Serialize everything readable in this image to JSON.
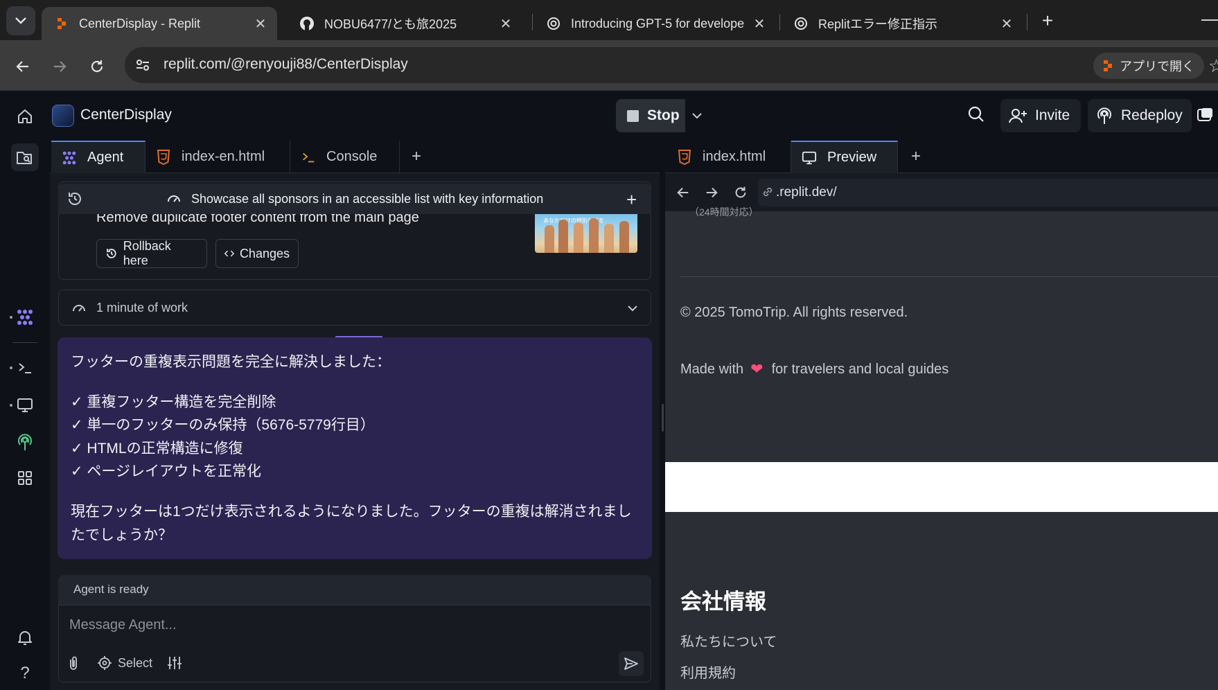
{
  "browser": {
    "tabs": [
      {
        "title": "CenterDisplay - Replit",
        "icon": "replit-icon"
      },
      {
        "title": "NOBU6477/とも旅2025",
        "icon": "github-icon"
      },
      {
        "title": "Introducing GPT-5 for develope",
        "icon": "openai-icon"
      },
      {
        "title": "Replitエラー修正指示",
        "icon": "openai-icon"
      }
    ],
    "url": "replit.com/@renyouji88/CenterDisplay",
    "open_in_app_label": "アプリで開く"
  },
  "header": {
    "project_name": "CenterDisplay",
    "stop_label": "Stop",
    "invite_label": "Invite",
    "redeploy_label": "Redeploy"
  },
  "agent_pane": {
    "tabs": [
      {
        "label": "Agent",
        "icon": "agent-icon"
      },
      {
        "label": "index-en.html",
        "icon": "html-icon"
      },
      {
        "label": "Console",
        "icon": "terminal-icon"
      }
    ],
    "pinned_task": "Showcase all sponsors in an accessible list with key information",
    "checkpoint": {
      "title": "Remove duplicate footer content from the main page",
      "rollback_label": "Rollback here",
      "changes_label": "Changes",
      "thumbnail_text": "あなただけの特別な旅を"
    },
    "work_summary": "1 minute of work",
    "message": {
      "lines": [
        "フッターの重複表示問題を完全に解決しました：",
        "✓ 重複フッター構造を完全削除",
        "✓ 単一のフッターのみ保持（5676-5779行目）",
        "✓ HTMLの正常構造に修復",
        "✓ ページレイアウトを正常化",
        "現在フッターは1つだけ表示されるようになりました。フッターの重複は解消されまし",
        "たでしょうか？"
      ]
    },
    "input": {
      "status": "Agent is ready",
      "placeholder": "Message Agent...",
      "select_label": "Select"
    }
  },
  "preview_pane": {
    "tabs": [
      {
        "label": "index.html",
        "icon": "html-icon"
      },
      {
        "label": "Preview",
        "icon": "monitor-icon"
      }
    ],
    "url": ".replit.dev/",
    "site": {
      "cut_text": "（24時間対応）",
      "copyright": "© 2025 TomoTrip. All rights reserved.",
      "made_with_prefix": "Made with",
      "made_with_suffix": "for travelers and local guides",
      "heading": "会社情報",
      "links": [
        "私たちについて",
        "利用規約"
      ]
    }
  },
  "colors": {
    "accent": "#4a8cff",
    "agent_bubble": "#2b2450",
    "heart": "#ff4d7a"
  }
}
